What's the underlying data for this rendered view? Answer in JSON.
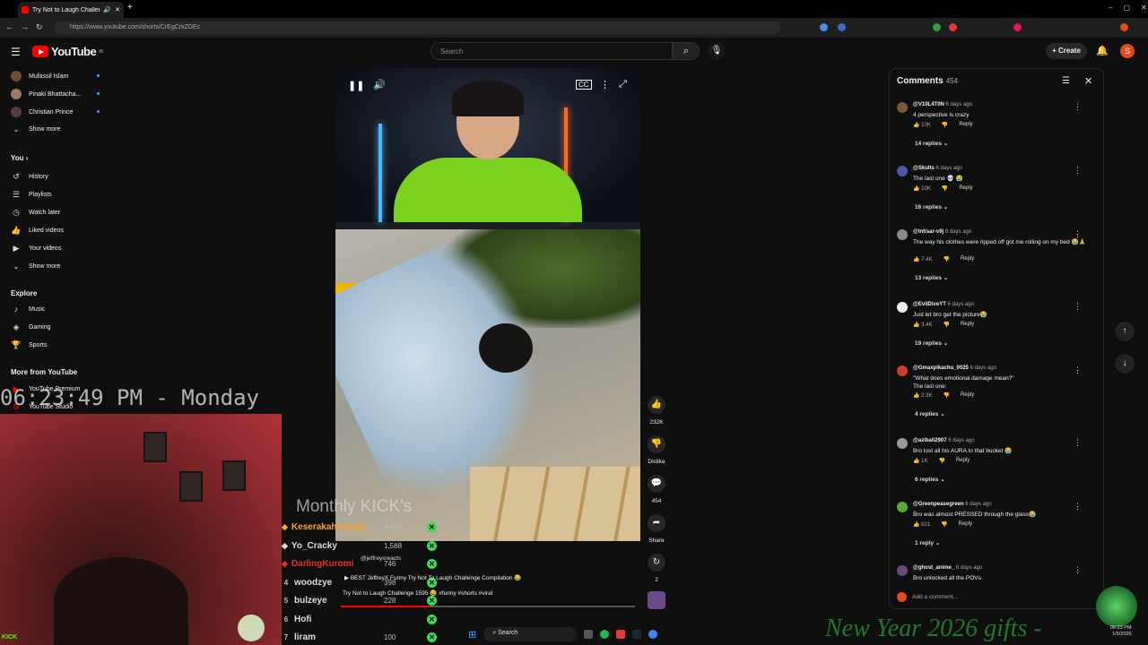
{
  "browser": {
    "tab_title": "Try Not to Laugh Challenge",
    "url": "https://www.youtube.com/shorts/CrEgCrkZDEc"
  },
  "header": {
    "logo": "YouTube",
    "logo_sup": "80",
    "search_placeholder": "Search",
    "create_label": "Create",
    "avatar_letter": "S"
  },
  "sidebar": {
    "subscriptions": [
      {
        "name": "Mufassil Islam"
      },
      {
        "name": "Pinaki Bhattacha..."
      },
      {
        "name": "Christian Prince"
      }
    ],
    "show_more": "Show more",
    "you_heading": "You",
    "you_items": [
      "History",
      "Playlists",
      "Watch later",
      "Liked videos",
      "Your videos",
      "Show more"
    ],
    "explore_heading": "Explore",
    "explore_items": [
      "Music",
      "Gaming",
      "Sports"
    ],
    "more_heading": "More from YouTube",
    "more_items": [
      "YouTube Premium",
      "YouTube Studio"
    ]
  },
  "actions": {
    "likes": "232K",
    "dislike": "Dislike",
    "comments": "454",
    "share": "Share",
    "remix": "2"
  },
  "comments": {
    "title": "Comments",
    "count": "454",
    "items": [
      {
        "user": "@V10L4T0N",
        "age": "6 days ago",
        "text": "4 perspective is crazy",
        "likes": "10K",
        "replies": "14 replies",
        "color": "#7a5a3a"
      },
      {
        "user": "@Skults",
        "age": "6 days ago",
        "text": "The last one 💀 😭",
        "likes": "10K",
        "replies": "16 replies",
        "color": "#4a5aa8"
      },
      {
        "user": "@Intisar-v9j",
        "age": "6 days ago",
        "text": "The way his clothes were ripped off got me rolling on my bed 😭🙏",
        "likes": "7.4K",
        "replies": "13 replies",
        "color": "#8a8a8a"
      },
      {
        "user": "@EvilDiveYT",
        "age": "6 days ago",
        "text": "Just let bro get the picture😭",
        "likes": "3.4K",
        "replies": "19 replies",
        "color": "#eeeeee"
      },
      {
        "user": "@Gmaxpikachu_0025",
        "age": "6 days ago",
        "text": "\"What does emotional damage mean?\"\nThe last one:",
        "likes": "2.3K",
        "replies": "4 replies",
        "color": "#d23c2a"
      },
      {
        "user": "@azibali2907",
        "age": "6 days ago",
        "text": "Bro lost all his AURA to that bucket 😭",
        "likes": "1K",
        "replies": "6 replies",
        "color": "#999999"
      },
      {
        "user": "@Greenpeasegreen",
        "age": "6 days ago",
        "text": "Bro was almost PRESSED through the glass😭",
        "likes": "821",
        "replies": "1 reply",
        "color": "#5aa83a"
      },
      {
        "user": "@ghost_anime_",
        "age": "6 days ago",
        "text": "Bro unlocked all the POVs",
        "likes": "",
        "replies": "",
        "color": "#6a4a7a"
      }
    ],
    "reply_label": "Reply",
    "add_placeholder": "Add a comment..."
  },
  "overlay": {
    "clock": "06:23:49 PM - Monday",
    "monthly": "Monthly KICK's",
    "leaderboard": [
      {
        "rank": "",
        "name": "KeserakahanRaja",
        "points": "4,656",
        "color": "#f5a623"
      },
      {
        "rank": "",
        "name": "Yo_Cracky",
        "points": "1,588",
        "color": "#dddddd"
      },
      {
        "rank": "",
        "name": "DarlingKuromi",
        "points": "746",
        "color": "#e8302a"
      },
      {
        "rank": "4",
        "name": "woodzye",
        "points": "398",
        "color": "#dddddd"
      },
      {
        "rank": "5",
        "name": "bulzeye",
        "points": "228",
        "color": "#dddddd"
      },
      {
        "rank": "6",
        "name": "Hofi",
        "points": "",
        "color": "#dddddd"
      },
      {
        "rank": "7",
        "name": "liram",
        "points": "100",
        "color": "#dddddd"
      }
    ],
    "channel": "@jeffreyxreacts",
    "video_desc1": "BEST JeffreyX Funny Try Not To Laugh Challenge Compilation 😂",
    "video_desc2": "Try Not to Laugh Challenge 1595 😂 #funny #shorts #viral",
    "new_year": "New Year 2026 gifts -",
    "kick": "KICK"
  },
  "taskbar": {
    "search": "Search",
    "time": "06:23 PM",
    "date": "1/5/2026"
  }
}
